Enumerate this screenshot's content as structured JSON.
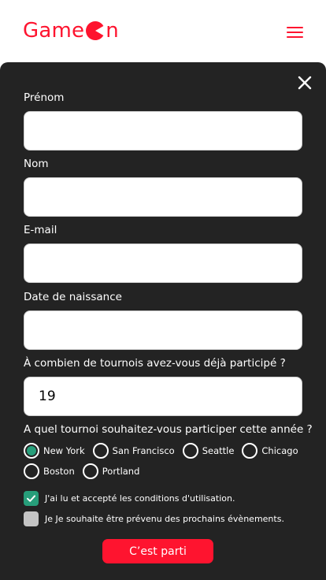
{
  "header": {
    "logo_left": "Game",
    "logo_right": "n",
    "brand_color": "#fe142f"
  },
  "form": {
    "first_name": {
      "label": "Prénom",
      "value": ""
    },
    "last_name": {
      "label": "Nom",
      "value": ""
    },
    "email": {
      "label": "E-mail",
      "value": ""
    },
    "birthdate": {
      "label": "Date de naissance",
      "value": ""
    },
    "tournaments": {
      "label": "À combien de tournois avez-vous déjà participé ?",
      "value": "19"
    },
    "location_question": "A quel tournoi souhaitez-vous participer cette année ?",
    "locations": [
      {
        "label": "New York",
        "checked": true
      },
      {
        "label": "San Francisco",
        "checked": false
      },
      {
        "label": "Seattle",
        "checked": false
      },
      {
        "label": "Chicago",
        "checked": false
      },
      {
        "label": "Boston",
        "checked": false
      },
      {
        "label": "Portland",
        "checked": false
      }
    ],
    "terms": {
      "label": "J'ai lu et accepté les conditions d'utilisation.",
      "checked": true
    },
    "newsletter": {
      "label": "Je Je souhaite être prévenu des prochains évènements.",
      "checked": false
    },
    "submit_label": "C’est parti"
  },
  "colors": {
    "modal_bg": "#232323",
    "check_green": "#279e7a",
    "unchecked_grey": "#c4c4c4"
  },
  "icons": {
    "menu": "hamburger-icon",
    "close": "close-icon",
    "logo_mark": "pacman-icon"
  }
}
